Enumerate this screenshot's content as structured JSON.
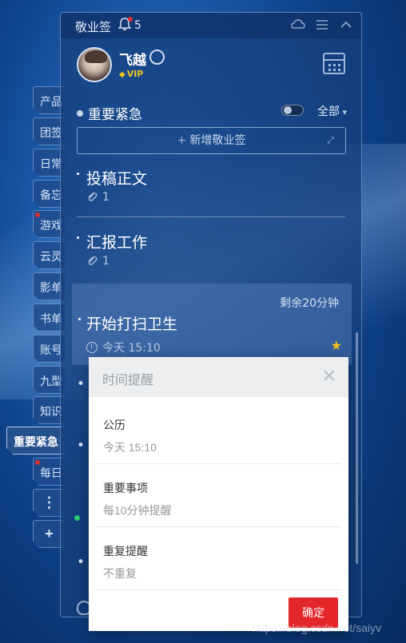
{
  "app": {
    "title": "敬业签",
    "notification_count": "5",
    "colors": {
      "accent_red": "#e3272b",
      "badge_red": "#e03030",
      "vip_gold": "#f0c420",
      "star": "#f4c21c",
      "online_green": "#2ecc71"
    }
  },
  "sidebar": {
    "tabs": [
      {
        "label": "产品",
        "dot": false
      },
      {
        "label": "团签",
        "dot": false
      },
      {
        "label": "日常",
        "dot": false
      },
      {
        "label": "备忘",
        "dot": false
      },
      {
        "label": "游戏",
        "dot": true
      },
      {
        "label": "云灵",
        "dot": false
      },
      {
        "label": "影单",
        "dot": false
      },
      {
        "label": "书单",
        "dot": false
      },
      {
        "label": "账号",
        "dot": false
      },
      {
        "label": "九型",
        "dot": false
      },
      {
        "label": "知识",
        "dot": false
      },
      {
        "label": "重要紧急",
        "dot": false,
        "active": true
      },
      {
        "label": "每日",
        "dot": true
      }
    ],
    "more_label": "⋮",
    "add_label": "+"
  },
  "user": {
    "name": "飞越",
    "badge": "VIP"
  },
  "category": {
    "name": "重要紧急",
    "filter": "全部"
  },
  "add_button": {
    "label": "新增敬业签"
  },
  "notes": [
    {
      "title": "投稿正文",
      "attachments": "1"
    },
    {
      "title": "汇报工作",
      "attachments": "1"
    }
  ],
  "active_note": {
    "remaining": "剩余20分钟",
    "title": "开始打扫卫生",
    "time": "今天 15:10",
    "starred": true
  },
  "reminder_dialog": {
    "title": "时间提醒",
    "sections": [
      {
        "label": "公历",
        "value": "今天  15:10"
      },
      {
        "label": "重要事项",
        "value": "每10分钟提醒"
      },
      {
        "label": "重复提醒",
        "value": "不重复"
      }
    ],
    "confirm_label": "确定"
  },
  "watermark": "https://blog.csdn.net/saiyv"
}
